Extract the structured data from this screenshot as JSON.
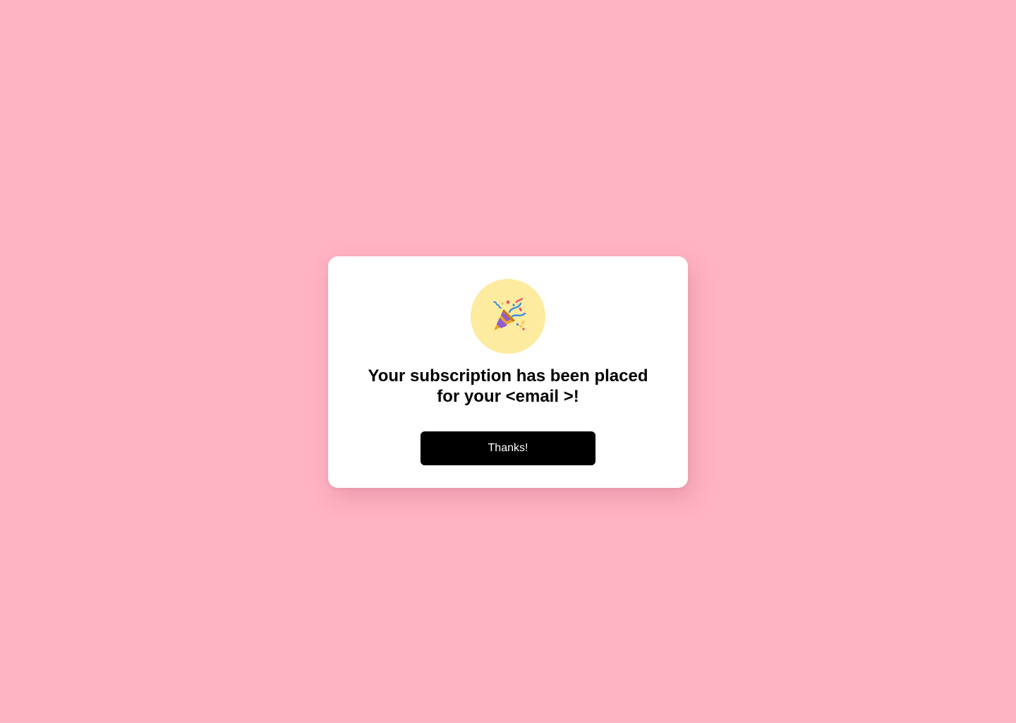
{
  "modal": {
    "icon": "party-popper-icon",
    "title_line1": "Your subscription has been placed",
    "title_line2": "for your <email >!",
    "button_label": "Thanks!"
  },
  "colors": {
    "background": "#FFB3C3",
    "card": "#FFFFFF",
    "icon_circle": "#FDEB9F",
    "button": "#000000",
    "button_text": "#FFFFFF"
  }
}
